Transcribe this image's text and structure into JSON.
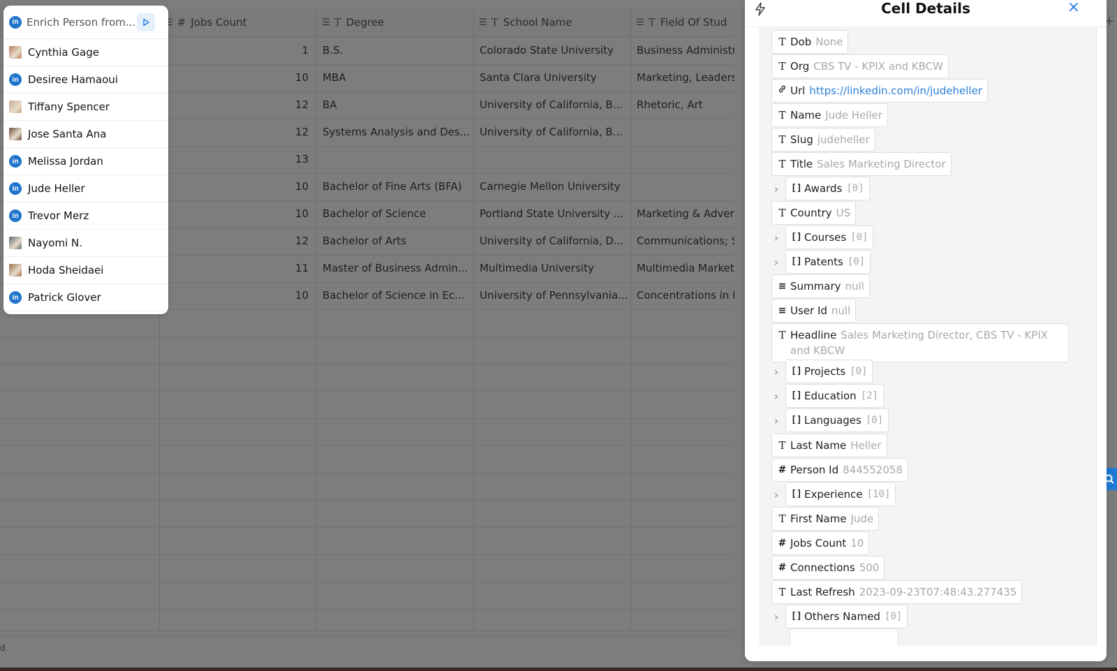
{
  "grid": {
    "columns": [
      {
        "key": "jobs",
        "label": "Jobs Count",
        "type_icon": "#"
      },
      {
        "key": "degree",
        "label": "Degree",
        "type_icon": "T"
      },
      {
        "key": "school",
        "label": "School Name",
        "type_icon": "T"
      },
      {
        "key": "field",
        "label": "Field Of Stud",
        "type_icon": "T"
      }
    ],
    "rows": [
      {
        "jobs": "1",
        "degree": "B.S.",
        "school": "Colorado State University",
        "field": "Business Administr"
      },
      {
        "jobs": "10",
        "degree": "MBA",
        "school": "Santa Clara University",
        "field": "Marketing, Leaders"
      },
      {
        "jobs": "12",
        "degree": "BA",
        "school": "University of California, B...",
        "field": "Rhetoric, Art"
      },
      {
        "jobs": "12",
        "degree": "Systems Analysis and Des...",
        "school": "University of California, B...",
        "field": ""
      },
      {
        "jobs": "13",
        "degree": "",
        "school": "",
        "field": ""
      },
      {
        "jobs": "10",
        "degree": "Bachelor of Fine Arts (BFA)",
        "school": "Carnegie Mellon University",
        "field": ""
      },
      {
        "jobs": "10",
        "degree": "Bachelor of Science",
        "school": "Portland State University ...",
        "field": "Marketing & Advert"
      },
      {
        "jobs": "12",
        "degree": "Bachelor of Arts",
        "school": "University of California, D...",
        "field": "Communications; S"
      },
      {
        "jobs": "11",
        "degree": "Master of Business Admin...",
        "school": "Multimedia University",
        "field": "Multimedia Marketi"
      },
      {
        "jobs": "10",
        "degree": "Bachelor of Science in Ec...",
        "school": "University of Pennsylvania...",
        "field": "Concentrations in F"
      }
    ],
    "footer_text": "d",
    "add_column_glyph": "+"
  },
  "dropdown": {
    "title": "Enrich Person from...",
    "items": [
      {
        "name": "Cynthia Gage",
        "icon": "photo",
        "color": "#b87a5a"
      },
      {
        "name": "Desiree Hamaoui",
        "icon": "linkedin"
      },
      {
        "name": "Tiffany Spencer",
        "icon": "photo",
        "color": "#c9a98a"
      },
      {
        "name": "Jose Santa Ana",
        "icon": "photo",
        "color": "#6b4a3a"
      },
      {
        "name": "Melissa Jordan",
        "icon": "linkedin"
      },
      {
        "name": "Jude Heller",
        "icon": "linkedin"
      },
      {
        "name": "Trevor Merz",
        "icon": "linkedin"
      },
      {
        "name": "Nayomi N.",
        "icon": "photo",
        "color": "#5a6a6a"
      },
      {
        "name": "Hoda Sheidaei",
        "icon": "photo",
        "color": "#9a6a4a"
      },
      {
        "name": "Patrick Glover",
        "icon": "linkedin"
      }
    ]
  },
  "panel": {
    "title": "Cell Details",
    "close_glyph": "×",
    "fields": [
      {
        "icon": "T",
        "key": "Dob",
        "value": "None"
      },
      {
        "icon": "T",
        "key": "Org",
        "value": "CBS TV - KPIX and KBCW"
      },
      {
        "icon": "link",
        "key": "Url",
        "value": "https://linkedin.com/in/judeheller"
      },
      {
        "icon": "T",
        "key": "Name",
        "value": "Jude Heller"
      },
      {
        "icon": "T",
        "key": "Slug",
        "value": "judeheller"
      },
      {
        "icon": "T",
        "key": "Title",
        "value": "Sales Marketing Director"
      },
      {
        "icon": "[]",
        "key": "Awards",
        "value": "[0]",
        "expandable": true
      },
      {
        "icon": "T",
        "key": "Country",
        "value": "US"
      },
      {
        "icon": "[]",
        "key": "Courses",
        "value": "[0]",
        "expandable": true
      },
      {
        "icon": "[]",
        "key": "Patents",
        "value": "[0]",
        "expandable": true
      },
      {
        "icon": "lines",
        "key": "Summary",
        "value": "null"
      },
      {
        "icon": "lines",
        "key": "User Id",
        "value": "null"
      },
      {
        "icon": "T",
        "key": "Headline",
        "value": "Sales Marketing Director, CBS TV - KPIX and KBCW",
        "wrap": true
      },
      {
        "icon": "[]",
        "key": "Projects",
        "value": "[0]",
        "expandable": true
      },
      {
        "icon": "[]",
        "key": "Education",
        "value": "[2]",
        "expandable": true
      },
      {
        "icon": "[]",
        "key": "Languages",
        "value": "[0]",
        "expandable": true
      },
      {
        "icon": "T",
        "key": "Last Name",
        "value": "Heller"
      },
      {
        "icon": "#",
        "key": "Person Id",
        "value": "844552058"
      },
      {
        "icon": "[]",
        "key": "Experience",
        "value": "[10]",
        "expandable": true
      },
      {
        "icon": "T",
        "key": "First Name",
        "value": "Jude"
      },
      {
        "icon": "#",
        "key": "Jobs Count",
        "value": "10"
      },
      {
        "icon": "#",
        "key": "Connections",
        "value": "500"
      },
      {
        "icon": "T",
        "key": "Last Refresh",
        "value": "2023-09-23T07:48:43.277435"
      },
      {
        "icon": "[]",
        "key": "Others Named",
        "value": "[0]",
        "expandable": true
      }
    ]
  }
}
